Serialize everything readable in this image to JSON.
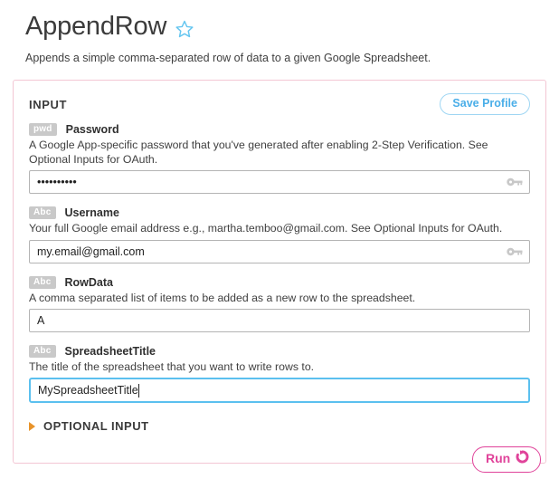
{
  "header": {
    "title": "AppendRow",
    "favorite_icon": "star-icon",
    "subtitle": "Appends a simple comma-separated row of data to a given Google Spreadsheet."
  },
  "panel": {
    "section_label": "INPUT",
    "save_profile_label": "Save Profile",
    "border_color": "#f3c6d4",
    "fields": [
      {
        "type_badge": "pwd",
        "name": "Password",
        "description": "A Google App-specific password that you've generated after enabling 2-Step Verification. See Optional Inputs for OAuth.",
        "value": "••••••••••",
        "placeholder": "",
        "trailing_icon": "key-icon",
        "focused": false
      },
      {
        "type_badge": "Abc",
        "name": "Username",
        "description": "Your full Google email address e.g., martha.temboo@gmail.com. See Optional Inputs for OAuth.",
        "value": "my.email@gmail.com",
        "placeholder": "",
        "trailing_icon": "key-icon",
        "focused": false
      },
      {
        "type_badge": "Abc",
        "name": "RowData",
        "description": "A comma separated list of items to be added as a new row to the spreadsheet.",
        "value": "A",
        "placeholder": "",
        "trailing_icon": "",
        "focused": false
      },
      {
        "type_badge": "Abc",
        "name": "SpreadsheetTitle",
        "description": "The title of the spreadsheet that you want to write rows to.",
        "value": "MySpreadsheetTitle",
        "placeholder": "",
        "trailing_icon": "",
        "focused": true
      }
    ]
  },
  "optional": {
    "label": "OPTIONAL INPUT",
    "disclosure_icon": "triangle-right-icon",
    "expanded": false
  },
  "run": {
    "label": "Run",
    "icon": "refresh-circle-icon",
    "accent_color": "#e0439a"
  },
  "colors": {
    "accent_blue": "#4aaee8",
    "accent_pink": "#e0439a",
    "badge_gray": "#c9c9c9",
    "focus_border": "#5bc0ef"
  }
}
